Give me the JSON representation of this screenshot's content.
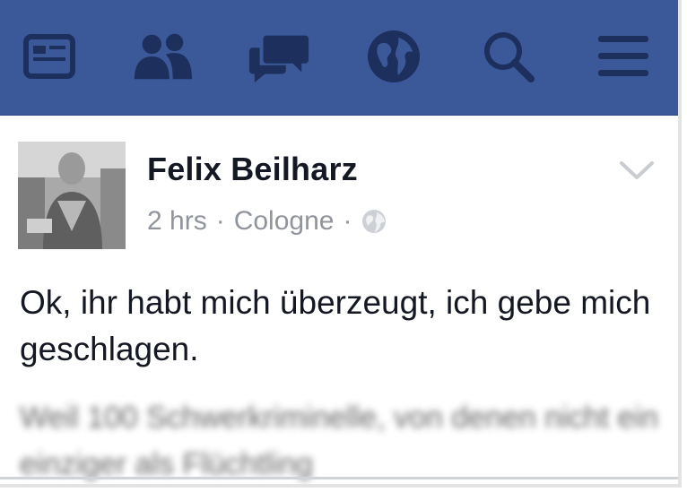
{
  "navbar": {
    "color": "#3b5998",
    "icons": [
      "news-feed-icon",
      "friends-icon",
      "messages-icon",
      "notifications-globe-icon",
      "search-icon",
      "menu-icon"
    ]
  },
  "post": {
    "author": "Felix Beilharz",
    "time": "2 hrs",
    "location": "Cologne",
    "separator": "·",
    "privacy_icon": "globe-icon",
    "text": "Ok, ihr habt mich überzeugt, ich gebe mich geschlagen.",
    "blurred_text": "Weil 100 Schwerkriminelle, von denen nicht ein einziger als Flüchtling"
  }
}
